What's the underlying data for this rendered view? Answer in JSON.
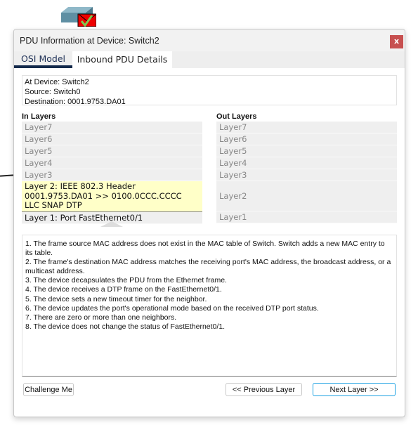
{
  "background": {
    "device_icon": "switch-icon",
    "pdu_icon": "envelope-check-icon"
  },
  "dialog": {
    "title": "PDU Information at Device: Switch2",
    "close_label": "x",
    "tabs": [
      {
        "label": "OSI Model",
        "active": true
      },
      {
        "label": "Inbound PDU Details",
        "active": false
      }
    ],
    "info": {
      "device": "At Device: Switch2",
      "source": "Source: Switch0",
      "destination": "Destination: 0001.9753.DA01"
    },
    "in_layers": {
      "label": "In Layers",
      "items": [
        "Layer7",
        "Layer6",
        "Layer5",
        "Layer4",
        "Layer3"
      ],
      "layer2": [
        "Layer 2: IEEE 802.3 Header",
        "0001.9753.DA01 >> 0100.0CCC.CCCC",
        "LLC SNAP DTP"
      ],
      "layer1": "Layer 1: Port FastEthernet0/1"
    },
    "out_layers": {
      "label": "Out Layers",
      "items": [
        "Layer7",
        "Layer6",
        "Layer5",
        "Layer4",
        "Layer3",
        "Layer2",
        "Layer1"
      ]
    },
    "description": [
      "1. The frame source MAC address does not exist in the MAC table of Switch. Switch adds a new MAC entry to its table.",
      "2. The frame's destination MAC address matches the receiving port's MAC address, the broadcast address, or a multicast address.",
      "3. The device decapsulates the PDU from the Ethernet frame.",
      "4. The device receives a DTP frame on the FastEthernet0/1.",
      "5. The device sets a new timeout timer for the neighbor.",
      "6. The device updates the port's operational mode based on the received DTP port status.",
      "7. There are zero or more than one neighbors.",
      "8. The device does not change the status of FastEthernet0/1."
    ],
    "buttons": {
      "challenge": "Challenge Me",
      "previous": "<< Previous Layer",
      "next": "Next Layer >>"
    },
    "colors": {
      "close": "#c75050",
      "active_layer": "#ffffc8",
      "tab_underline": "#13294b",
      "focus": "#1ba1e2"
    }
  }
}
